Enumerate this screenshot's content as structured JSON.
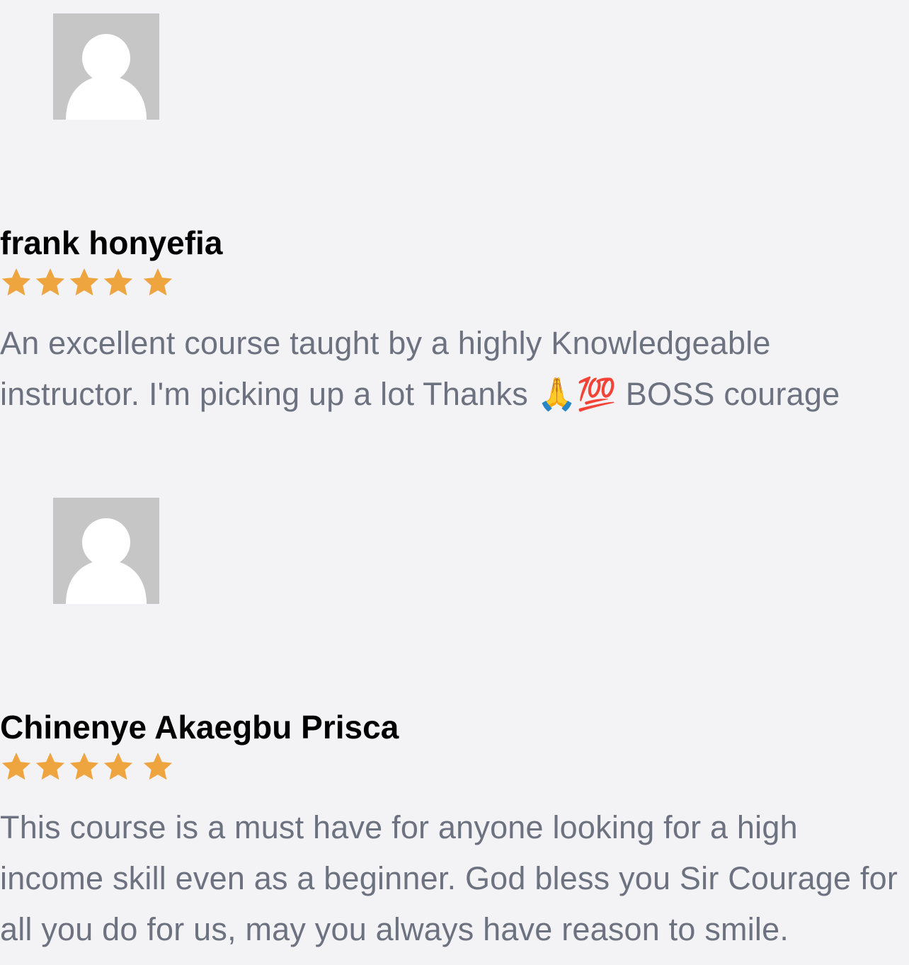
{
  "colors": {
    "background": "#f3f3f6",
    "star": "#efa53f",
    "name": "#000000",
    "review_text": "#6d7280",
    "avatar_bg": "#c6c6c6"
  },
  "reviews": [
    {
      "avatar_icon": "default-user-avatar-icon",
      "name": "frank honyefia",
      "rating": 5,
      "text": "An excellent course taught by a highly Knowledgeable instructor. I'm picking up a lot Thanks 🙏💯  BOSS courage"
    },
    {
      "avatar_icon": "default-user-avatar-icon",
      "name": "Chinenye Akaegbu Prisca",
      "rating": 5,
      "text": "This course is a must have for anyone looking for a high income skill even as a beginner. God bless you Sir Courage for all you do for us, may you always have reason to smile."
    }
  ]
}
